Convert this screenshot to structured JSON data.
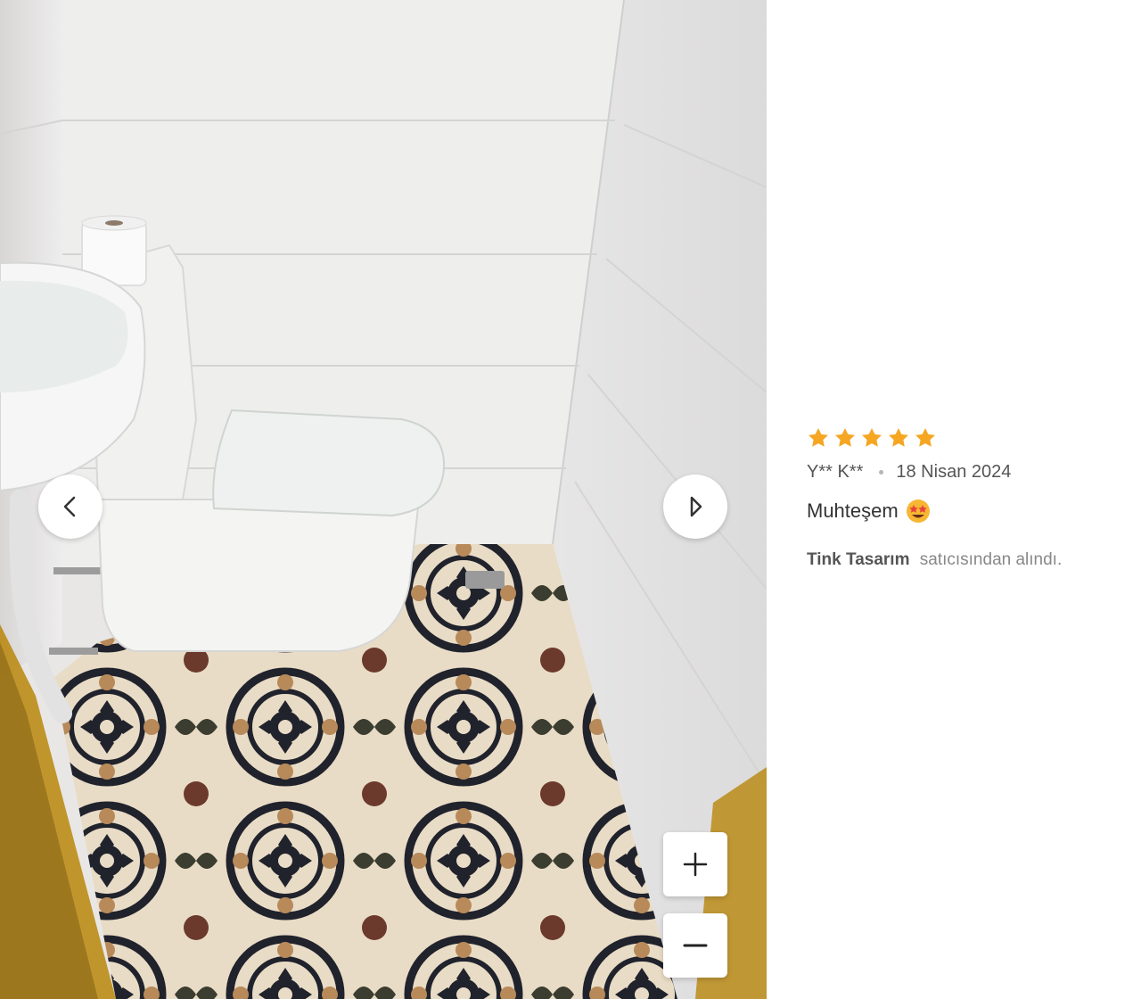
{
  "viewer": {
    "photo_alt": "review-photo-bathroom",
    "prev_icon": "chevron-left-icon",
    "next_icon": "chevron-right-icon",
    "zoom_in_icon": "plus-icon",
    "zoom_out_icon": "minus-icon"
  },
  "review": {
    "rating": 5,
    "rating_max": 5,
    "star_color": "#f5a623",
    "author": "Y** K**",
    "date": "18 Nisan 2024",
    "comment": "Muhteşem",
    "comment_emoji": "star-struck-emoji-icon",
    "seller_name": "Tink Tasarım",
    "seller_suffix": "satıcısından alındı."
  }
}
